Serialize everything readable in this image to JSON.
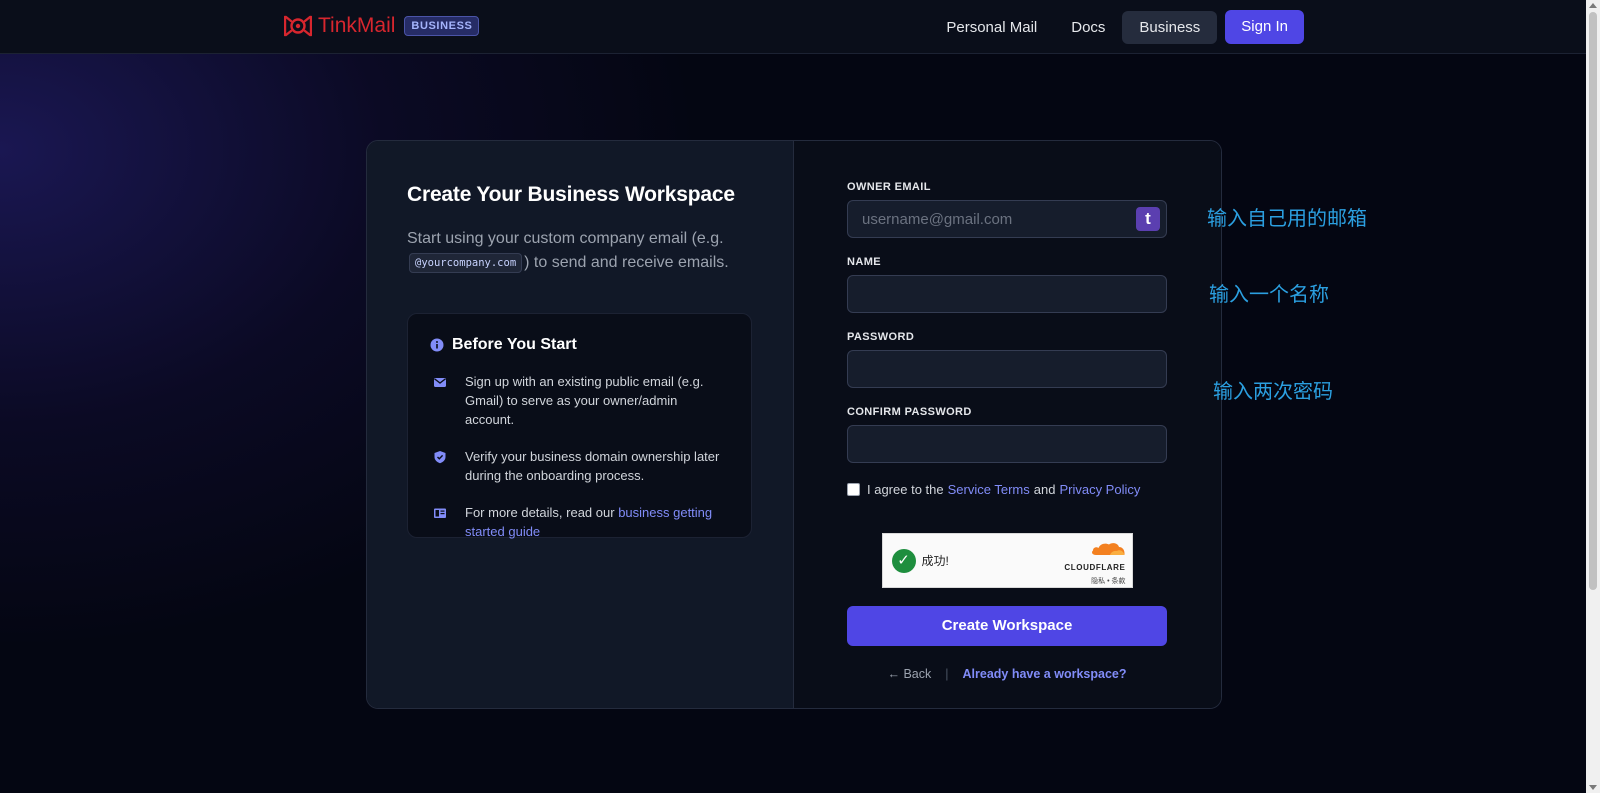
{
  "header": {
    "brand_name": "TinkMail",
    "brand_badge": "BUSINESS",
    "nav": [
      "Personal Mail",
      "Docs",
      "Business"
    ],
    "sign_in": "Sign In"
  },
  "left": {
    "title": "Create Your Business Workspace",
    "subtitle_pre": "Start using your custom company email (e.g.",
    "subtitle_code": "@yourcompany.com",
    "subtitle_post": ") to send and receive emails.",
    "info_title": "Before You Start",
    "items": [
      {
        "icon": "mail-icon",
        "text": "Sign up with an existing public email (e.g. Gmail) to serve as your owner/admin account."
      },
      {
        "icon": "shield-check-icon",
        "text": "Verify your business domain ownership later during the onboarding process."
      },
      {
        "icon": "book-icon",
        "text_pre": "For more details, read our ",
        "link": "business getting started guide"
      }
    ]
  },
  "form": {
    "owner_email_label": "OWNER EMAIL",
    "owner_email_placeholder": "username@gmail.com",
    "owner_email_value": "",
    "t_button": "t",
    "name_label": "NAME",
    "name_value": "",
    "password_label": "PASSWORD",
    "confirm_label": "CONFIRM PASSWORD",
    "agree_pre": "I agree to the",
    "service_terms": "Service Terms",
    "and": "and",
    "privacy_policy": "Privacy Policy",
    "captcha_status": "成功!",
    "captcha_brand": "CLOUDFLARE",
    "captcha_links": "隐私 • 条款",
    "create_button": "Create Workspace",
    "back": "← Back",
    "separator": "|",
    "already": "Already have a workspace?"
  },
  "annotations": [
    "输入自己用的邮箱",
    "输入一个名称",
    "输入两次密码"
  ],
  "colors": {
    "accent": "#4f46e5",
    "brand": "#d7262e",
    "link": "#818cf8",
    "annotation": "#2b9fe0"
  }
}
